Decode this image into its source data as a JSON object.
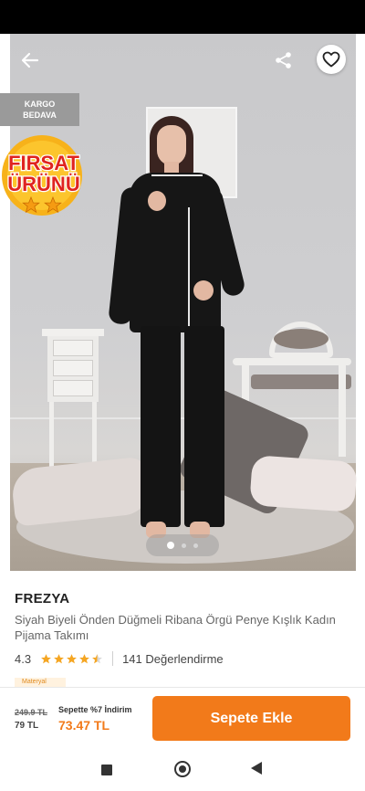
{
  "top_bar": {
    "back_icon": "arrow-left-icon",
    "share_icon": "share-icon",
    "favorite_icon": "heart-outline-icon"
  },
  "badges": {
    "free_shipping_line1": "KARGO",
    "free_shipping_line2": "BEDAVA",
    "deal_line1": "FIRSAT",
    "deal_line2": "ÜRÜNÜ",
    "deal_stars": 2
  },
  "gallery": {
    "image_count": 3,
    "active_index": 0
  },
  "product": {
    "brand": "FREZYA",
    "title": "Siyah Biyeli Önden Düğmeli Ribana Örgü Penye Kışlık Kadın Pijama Takımı",
    "rating": "4.3",
    "rating_value": 4.3,
    "review_count_text": "141 Değerlendirme",
    "tag": "Materyal"
  },
  "purchase": {
    "old_price": "249.9 TL",
    "price": "79 TL",
    "promo_text": "Sepette %7 İndirim",
    "final_price": "73.47 TL",
    "add_to_cart_label": "Sepete Ekle"
  },
  "colors": {
    "accent": "#f27a1a",
    "star": "#f5a623"
  },
  "system_nav": {
    "recents_icon": "square-icon",
    "home_icon": "circle-icon",
    "back_icon": "triangle-back-icon"
  }
}
